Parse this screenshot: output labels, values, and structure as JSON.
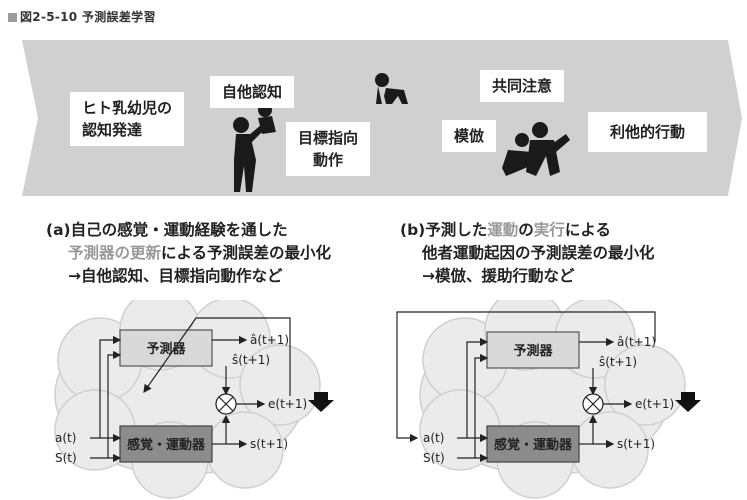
{
  "figure_title": "図2-5-10 予測誤差学習",
  "banner": {
    "labels": {
      "development": [
        "ヒト乳幼児の",
        "認知発達"
      ],
      "self_recognition": "自他認知",
      "goal_directed": [
        "目標指向",
        "動作"
      ],
      "imitation": "模倣",
      "joint_attention": "共同注意",
      "altruistic": "利他的行動"
    }
  },
  "captions": {
    "a": {
      "line1": "(a)自己の感覚・運動経験を通した",
      "line2_highlight": "予測器の更新",
      "line2_rest": "による予測誤差の最小化",
      "line3": "→自他認知、目標指向動作など"
    },
    "b": {
      "line1_pre": "(b)予測した",
      "line1_highlight1": "運動",
      "line1_mid": "の",
      "line1_highlight2": "実行",
      "line1_post": "による",
      "line2": "他者運動起因の予測誤差の最小化",
      "line3": "→模倣、援助行動など"
    }
  },
  "diagrams": {
    "a": {
      "predictor_label": "予測器",
      "sensorimotor_label": "感覚・運動器",
      "a_hat": "â(t+1)",
      "s_hat": "ŝ(t+1)",
      "error": "e(t+1)",
      "s_next": "s(t+1)",
      "a_in": "a(t)",
      "s_in": "S(t)"
    },
    "b": {
      "predictor_label": "予測器",
      "sensorimotor_label": "感覚・運動器",
      "a_hat": "â(t+1)",
      "s_hat": "ŝ(t+1)",
      "error": "e(t+1)",
      "s_next": "s(t+1)",
      "a_in": "a(t)",
      "s_in": "S(t)"
    }
  },
  "colors": {
    "predictor_fill": "#d9d9d9",
    "sensorimotor_fill": "#8c8c8c",
    "banner_fill": "#d0d0d0",
    "cloud_fill": "#ebebeb",
    "highlight_text": "#999999"
  }
}
